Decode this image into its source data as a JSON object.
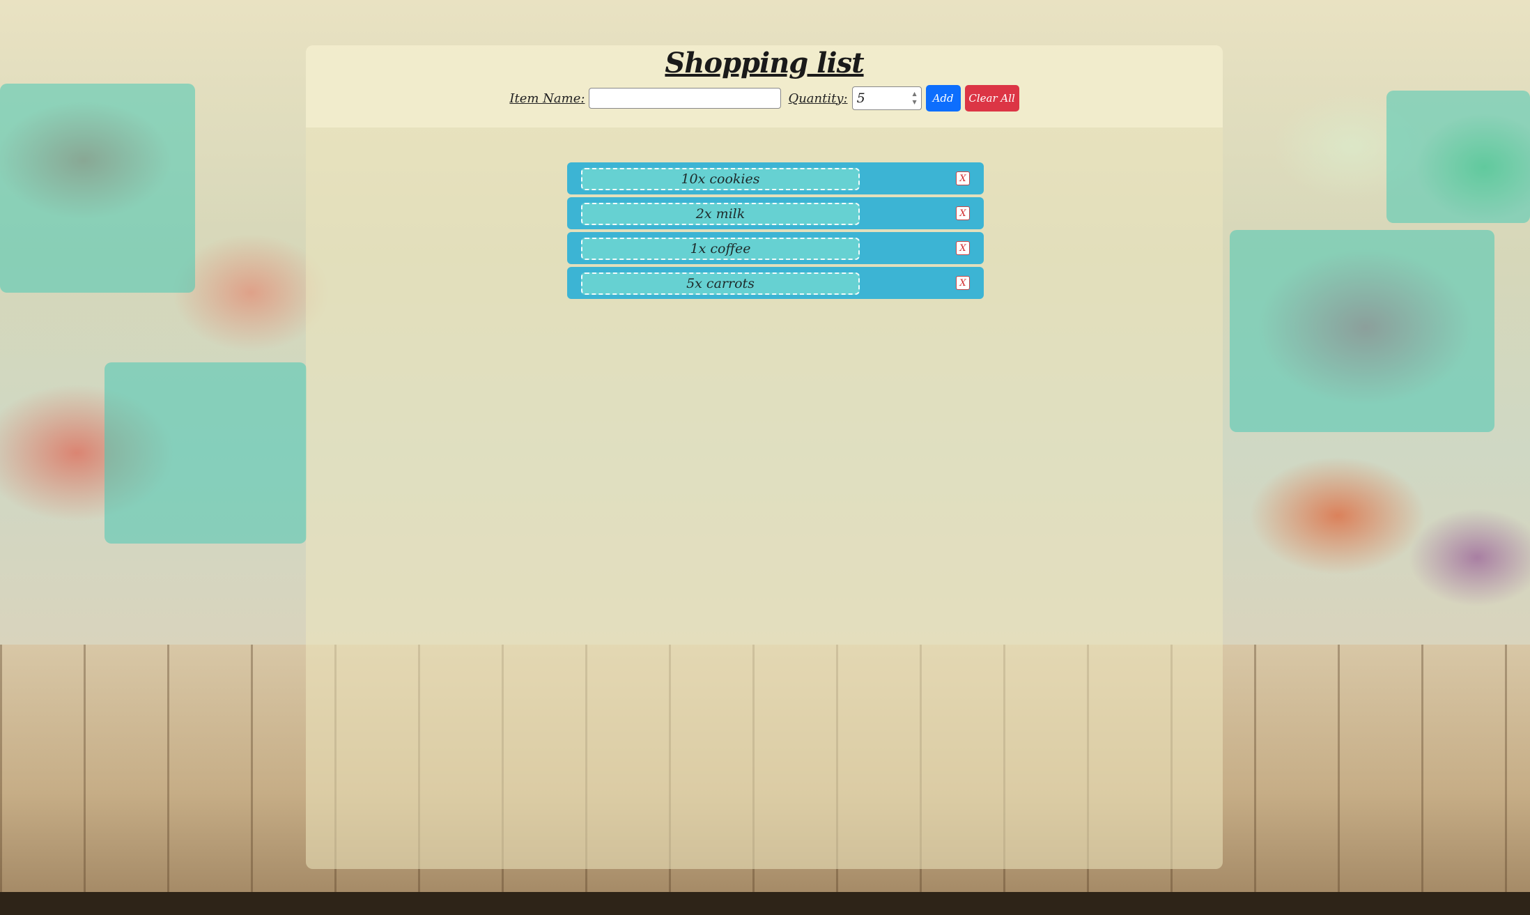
{
  "page": {
    "title": "Shopping list"
  },
  "form": {
    "item_label": "Item Name:",
    "item_value": "",
    "quantity_label": "Quantity:",
    "quantity_value": "5",
    "add_label": "Add",
    "clear_label": "Clear All"
  },
  "items": [
    {
      "text": "10x cookies",
      "remove_label": "X"
    },
    {
      "text": "2x milk",
      "remove_label": "X"
    },
    {
      "text": "1x coffee",
      "remove_label": "X"
    },
    {
      "text": "5x carrots",
      "remove_label": "X"
    }
  ],
  "colors": {
    "add_button": "#0d6efd",
    "clear_button": "#dc3545",
    "item_row": "#3cb4d4",
    "item_label": "#66d1d2"
  }
}
